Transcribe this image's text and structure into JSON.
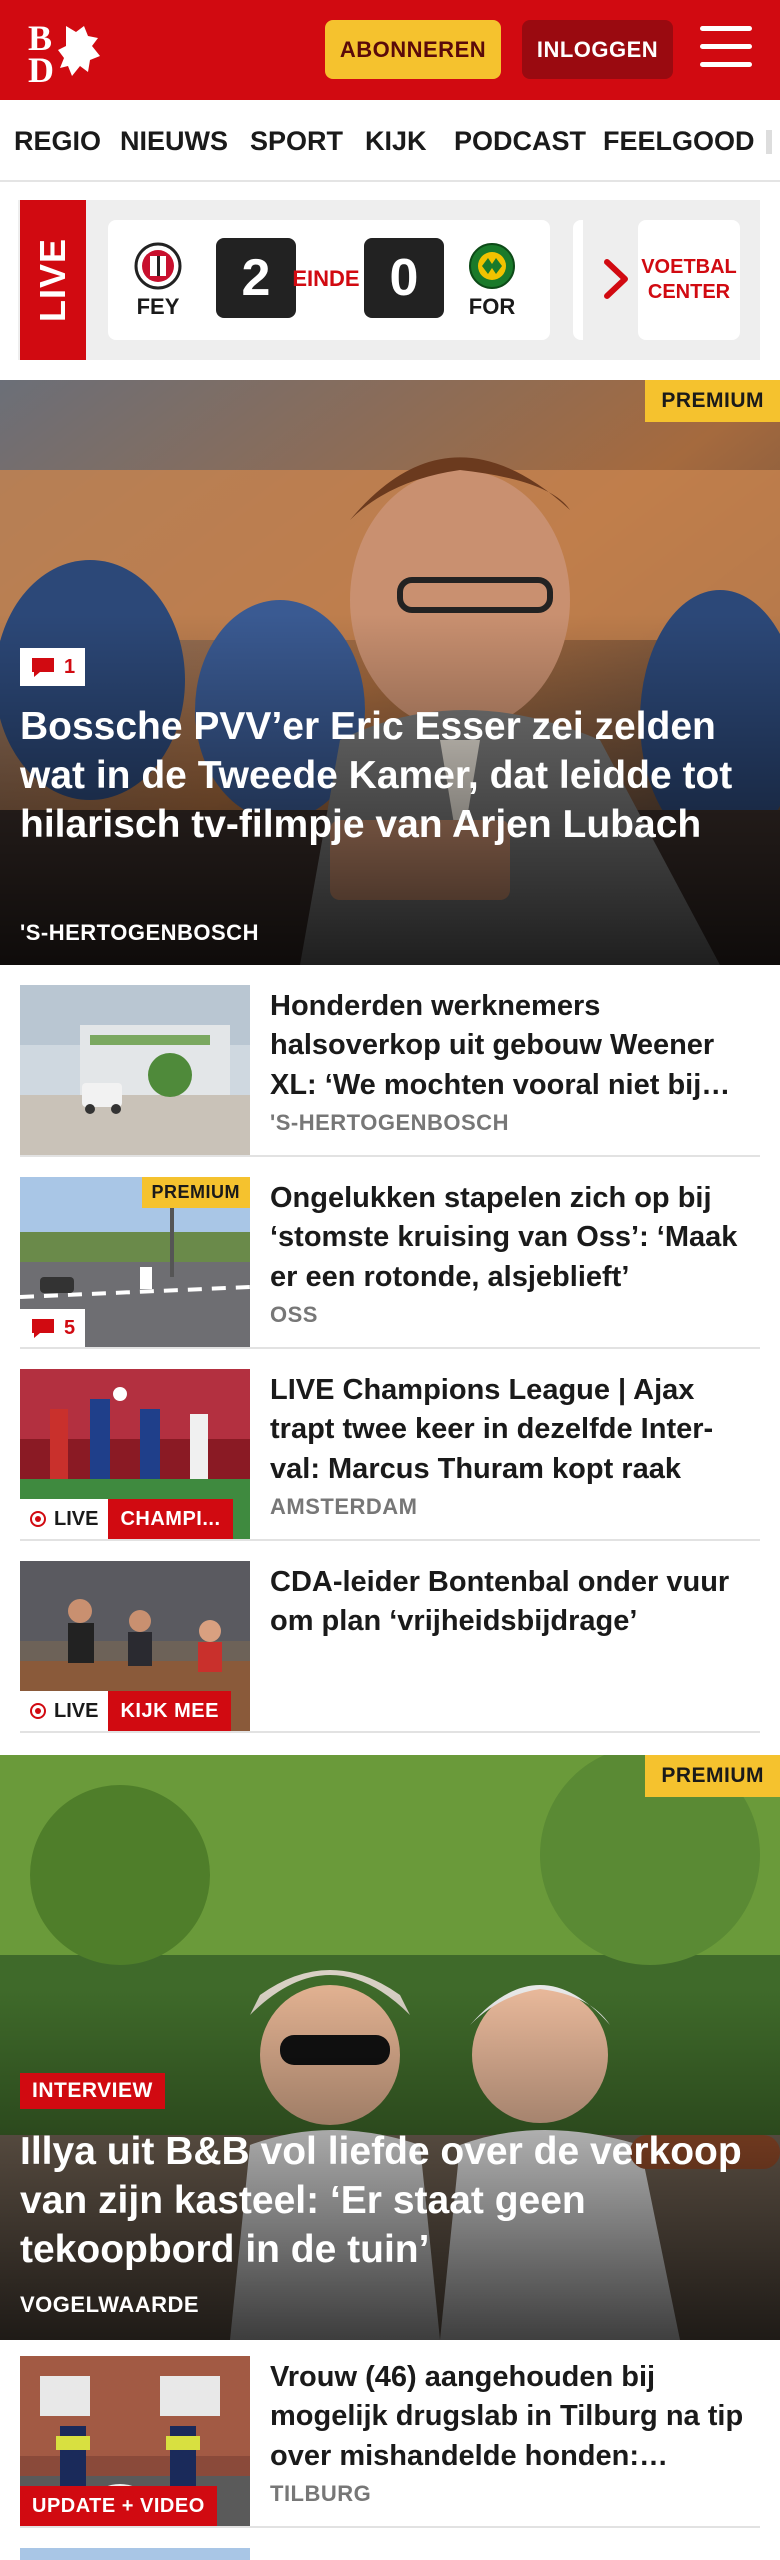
{
  "header": {
    "logo_text": "BD",
    "subscribe_label": "ABONNEREN",
    "login_label": "INLOGGEN"
  },
  "nav": {
    "items": [
      "REGIO",
      "NIEUWS",
      "SPORT",
      "KIJK",
      "PODCAST",
      "FEELGOOD"
    ]
  },
  "scorebar": {
    "live_label": "LIVE",
    "home_team": "FEY",
    "away_team": "FOR",
    "home_score": "2",
    "away_score": "0",
    "status": "EINDE",
    "center_button": "VOETBAL CENTER"
  },
  "hero1": {
    "badge": "PREMIUM",
    "comment_count": "1",
    "title": "Bossche PVV’er Eric Esser zei zelden wat in de Tweede Kamer, dat leidde tot hilarisch tv-filmpje van Arjen Lubach",
    "location": "'S-HERTOGENBOSCH"
  },
  "articles": [
    {
      "title": "Honderden werknemers halsoverkop uit gebouw Weener XL: ‘We mochten vooral niet bij…",
      "location": "'S-HERTOGENBOSCH"
    },
    {
      "title": "Ongelukken stapelen zich op bij ‘stomste kruising van Oss’: ‘Maak er een rotonde, alsjeblieft’",
      "location": "OSS",
      "badge": "PREMIUM",
      "comment_count": "5"
    },
    {
      "title": "LIVE Champions League | Ajax trapt twee keer in dezelfde Inter-val: Marcus Thuram kopt raak",
      "location": "AMSTERDAM",
      "live_label": "LIVE",
      "tag": "CHAMPI..."
    },
    {
      "title": "CDA-leider Bontenbal onder vuur om plan ‘vrijheidsbijdrage’",
      "live_label": "LIVE",
      "tag": "KIJK MEE"
    }
  ],
  "hero2": {
    "badge": "PREMIUM",
    "tag": "INTERVIEW",
    "title": "Illya uit B&B vol liefde over de verkoop van zijn kasteel: ‘Er staat geen tekoopbord in de tuin’",
    "location": "VOGELWAARDE"
  },
  "article5": {
    "title": "Vrouw (46) aangehouden bij mogelijk drugslab in Tilburg na tip over mishandelde honden:…",
    "location": "TILBURG",
    "tag": "UPDATE + VIDEO"
  },
  "colors": {
    "brand_red": "#d10a11",
    "premium_yellow": "#f5c22e",
    "dark_red": "#9a0a10"
  }
}
